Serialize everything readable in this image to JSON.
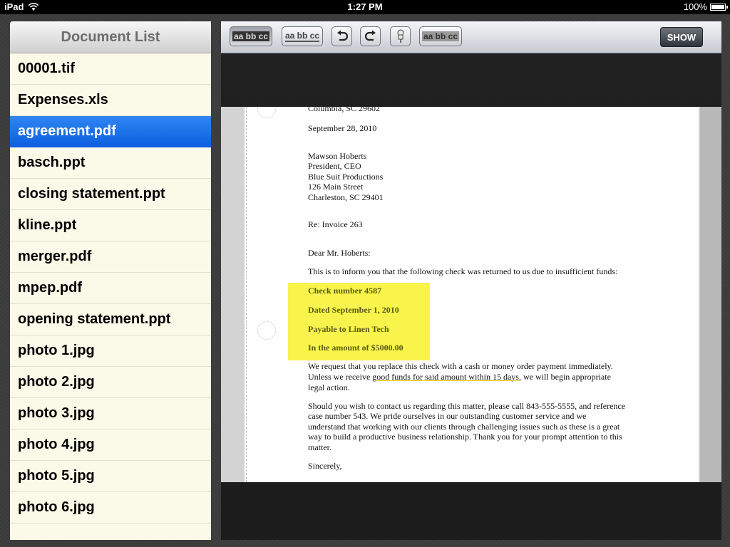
{
  "status": {
    "device": "iPad",
    "time": "1:27 PM",
    "battery": "100%",
    "battery_level": 1.0
  },
  "sidebar": {
    "title": "Document List",
    "items": [
      {
        "label": "00001.tif"
      },
      {
        "label": "Expenses.xls"
      },
      {
        "label": "agreement.pdf",
        "selected": true
      },
      {
        "label": "basch.ppt"
      },
      {
        "label": "closing statement.ppt"
      },
      {
        "label": "kline.ppt"
      },
      {
        "label": "merger.pdf"
      },
      {
        "label": "mpep.pdf"
      },
      {
        "label": "opening statement.ppt"
      },
      {
        "label": "photo 1.jpg"
      },
      {
        "label": "photo 2.jpg"
      },
      {
        "label": "photo 3.jpg"
      },
      {
        "label": "photo 4.jpg"
      },
      {
        "label": "photo 5.jpg"
      },
      {
        "label": "photo 6.jpg"
      }
    ]
  },
  "toolbar": {
    "highlight_label": "aa bb cc",
    "underline_label": "aa bb cc",
    "strike_label": "aa bb cc",
    "show_label": "SHOW"
  },
  "document": {
    "lines": {
      "city": "Columbia, SC 29602",
      "date": "September 28, 2010",
      "to_name": "Mawson Hoberts",
      "to_title": "President, CEO",
      "to_company": "Blue Suit Productions",
      "to_street": "126 Main Street",
      "to_city": "Charleston, SC 29401",
      "re": "Re: Invoice 263",
      "salutation": "Dear Mr. Hoberts:",
      "intro": "This is to inform you that the following check was returned to us due to insufficient funds:",
      "check": "Check number 4587",
      "dated": "Dated September 1, 2010",
      "payable": "Payable to Linen Tech",
      "amount": "In the amount of $5000.00",
      "p1a": "We request that you replace this check with a cash or money order payment immediately.",
      "p1b_pre": "Unless we receive ",
      "p1b_mark": "good funds for said amount within 15 days",
      "p1b_post": ", we will begin appropriate",
      "p1c": "legal action.",
      "p2a": "Should you wish to contact us regarding this matter, please call 843-555-5555, and reference",
      "p2b": "case number 543.  We pride ourselves in our outstanding customer service and we",
      "p2c": "understand that working with our clients through challenging issues such as these is a great",
      "p2d": "way to build a productive business relationship.  Thank you for your prompt attention to this",
      "p2e": "matter.",
      "closing": "Sincerely,"
    }
  },
  "colors": {
    "selected": "#1a6fe8",
    "highlight": "#f8f44b",
    "sidebar_bg": "#fbf9e8"
  }
}
